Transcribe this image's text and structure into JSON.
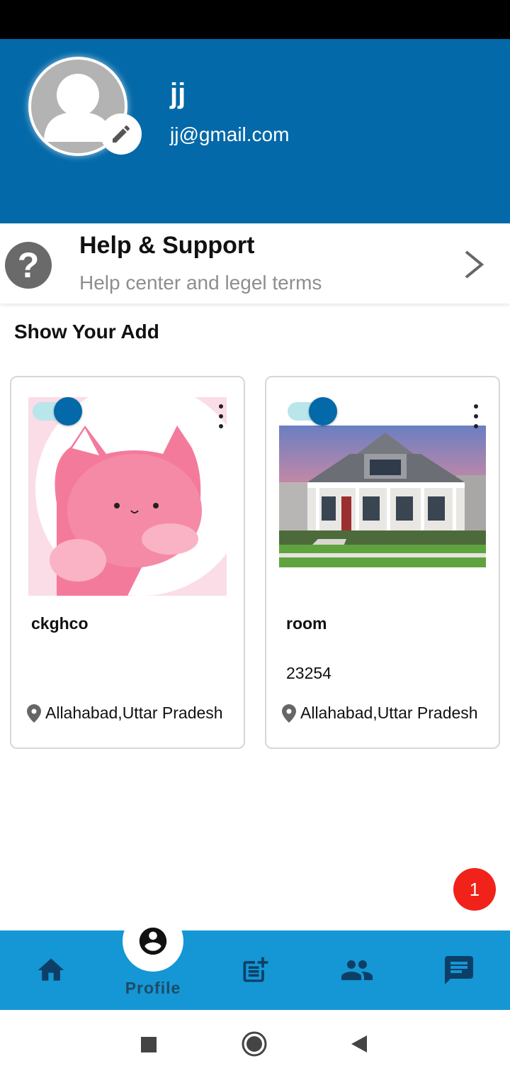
{
  "profile": {
    "name": "jj",
    "email": "jj@gmail.com"
  },
  "help": {
    "title": "Help & Support",
    "subtitle": "Help center and legel terms"
  },
  "section_title": "Show Your Add",
  "ads": [
    {
      "title": "ckghco",
      "price": "",
      "location": "Allahabad,Uttar Pradesh",
      "enabled": true,
      "image": "pink-cat-image"
    },
    {
      "title": "room",
      "price": "23254",
      "location": "Allahabad,Uttar Pradesh",
      "enabled": true,
      "image": "house-image"
    }
  ],
  "notification_count": "1",
  "bottom_nav": {
    "active_label": "Profile",
    "items": [
      "home-icon",
      "profile-icon",
      "post-add-icon",
      "people-icon",
      "chat-icon"
    ]
  },
  "colors": {
    "header": "#0369a8",
    "nav": "#1497d4",
    "badge": "#f0221a"
  }
}
